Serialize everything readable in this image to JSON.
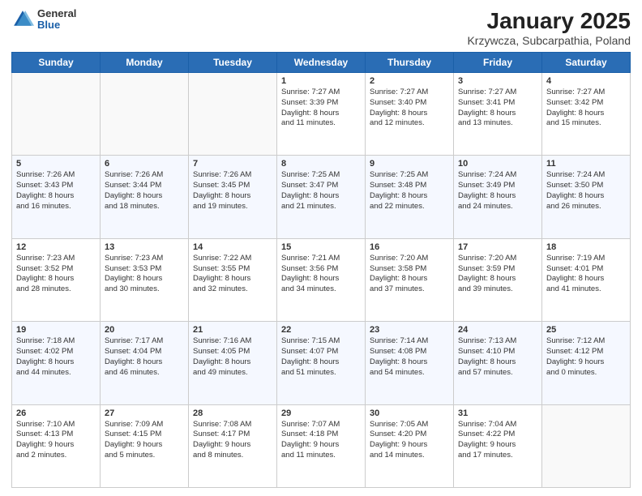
{
  "logo": {
    "general": "General",
    "blue": "Blue"
  },
  "title": "January 2025",
  "subtitle": "Krzywcza, Subcarpathia, Poland",
  "days_of_week": [
    "Sunday",
    "Monday",
    "Tuesday",
    "Wednesday",
    "Thursday",
    "Friday",
    "Saturday"
  ],
  "weeks": [
    [
      {
        "day": "",
        "info": ""
      },
      {
        "day": "",
        "info": ""
      },
      {
        "day": "",
        "info": ""
      },
      {
        "day": "1",
        "info": "Sunrise: 7:27 AM\nSunset: 3:39 PM\nDaylight: 8 hours\nand 11 minutes."
      },
      {
        "day": "2",
        "info": "Sunrise: 7:27 AM\nSunset: 3:40 PM\nDaylight: 8 hours\nand 12 minutes."
      },
      {
        "day": "3",
        "info": "Sunrise: 7:27 AM\nSunset: 3:41 PM\nDaylight: 8 hours\nand 13 minutes."
      },
      {
        "day": "4",
        "info": "Sunrise: 7:27 AM\nSunset: 3:42 PM\nDaylight: 8 hours\nand 15 minutes."
      }
    ],
    [
      {
        "day": "5",
        "info": "Sunrise: 7:26 AM\nSunset: 3:43 PM\nDaylight: 8 hours\nand 16 minutes."
      },
      {
        "day": "6",
        "info": "Sunrise: 7:26 AM\nSunset: 3:44 PM\nDaylight: 8 hours\nand 18 minutes."
      },
      {
        "day": "7",
        "info": "Sunrise: 7:26 AM\nSunset: 3:45 PM\nDaylight: 8 hours\nand 19 minutes."
      },
      {
        "day": "8",
        "info": "Sunrise: 7:25 AM\nSunset: 3:47 PM\nDaylight: 8 hours\nand 21 minutes."
      },
      {
        "day": "9",
        "info": "Sunrise: 7:25 AM\nSunset: 3:48 PM\nDaylight: 8 hours\nand 22 minutes."
      },
      {
        "day": "10",
        "info": "Sunrise: 7:24 AM\nSunset: 3:49 PM\nDaylight: 8 hours\nand 24 minutes."
      },
      {
        "day": "11",
        "info": "Sunrise: 7:24 AM\nSunset: 3:50 PM\nDaylight: 8 hours\nand 26 minutes."
      }
    ],
    [
      {
        "day": "12",
        "info": "Sunrise: 7:23 AM\nSunset: 3:52 PM\nDaylight: 8 hours\nand 28 minutes."
      },
      {
        "day": "13",
        "info": "Sunrise: 7:23 AM\nSunset: 3:53 PM\nDaylight: 8 hours\nand 30 minutes."
      },
      {
        "day": "14",
        "info": "Sunrise: 7:22 AM\nSunset: 3:55 PM\nDaylight: 8 hours\nand 32 minutes."
      },
      {
        "day": "15",
        "info": "Sunrise: 7:21 AM\nSunset: 3:56 PM\nDaylight: 8 hours\nand 34 minutes."
      },
      {
        "day": "16",
        "info": "Sunrise: 7:20 AM\nSunset: 3:58 PM\nDaylight: 8 hours\nand 37 minutes."
      },
      {
        "day": "17",
        "info": "Sunrise: 7:20 AM\nSunset: 3:59 PM\nDaylight: 8 hours\nand 39 minutes."
      },
      {
        "day": "18",
        "info": "Sunrise: 7:19 AM\nSunset: 4:01 PM\nDaylight: 8 hours\nand 41 minutes."
      }
    ],
    [
      {
        "day": "19",
        "info": "Sunrise: 7:18 AM\nSunset: 4:02 PM\nDaylight: 8 hours\nand 44 minutes."
      },
      {
        "day": "20",
        "info": "Sunrise: 7:17 AM\nSunset: 4:04 PM\nDaylight: 8 hours\nand 46 minutes."
      },
      {
        "day": "21",
        "info": "Sunrise: 7:16 AM\nSunset: 4:05 PM\nDaylight: 8 hours\nand 49 minutes."
      },
      {
        "day": "22",
        "info": "Sunrise: 7:15 AM\nSunset: 4:07 PM\nDaylight: 8 hours\nand 51 minutes."
      },
      {
        "day": "23",
        "info": "Sunrise: 7:14 AM\nSunset: 4:08 PM\nDaylight: 8 hours\nand 54 minutes."
      },
      {
        "day": "24",
        "info": "Sunrise: 7:13 AM\nSunset: 4:10 PM\nDaylight: 8 hours\nand 57 minutes."
      },
      {
        "day": "25",
        "info": "Sunrise: 7:12 AM\nSunset: 4:12 PM\nDaylight: 9 hours\nand 0 minutes."
      }
    ],
    [
      {
        "day": "26",
        "info": "Sunrise: 7:10 AM\nSunset: 4:13 PM\nDaylight: 9 hours\nand 2 minutes."
      },
      {
        "day": "27",
        "info": "Sunrise: 7:09 AM\nSunset: 4:15 PM\nDaylight: 9 hours\nand 5 minutes."
      },
      {
        "day": "28",
        "info": "Sunrise: 7:08 AM\nSunset: 4:17 PM\nDaylight: 9 hours\nand 8 minutes."
      },
      {
        "day": "29",
        "info": "Sunrise: 7:07 AM\nSunset: 4:18 PM\nDaylight: 9 hours\nand 11 minutes."
      },
      {
        "day": "30",
        "info": "Sunrise: 7:05 AM\nSunset: 4:20 PM\nDaylight: 9 hours\nand 14 minutes."
      },
      {
        "day": "31",
        "info": "Sunrise: 7:04 AM\nSunset: 4:22 PM\nDaylight: 9 hours\nand 17 minutes."
      },
      {
        "day": "",
        "info": ""
      }
    ]
  ]
}
